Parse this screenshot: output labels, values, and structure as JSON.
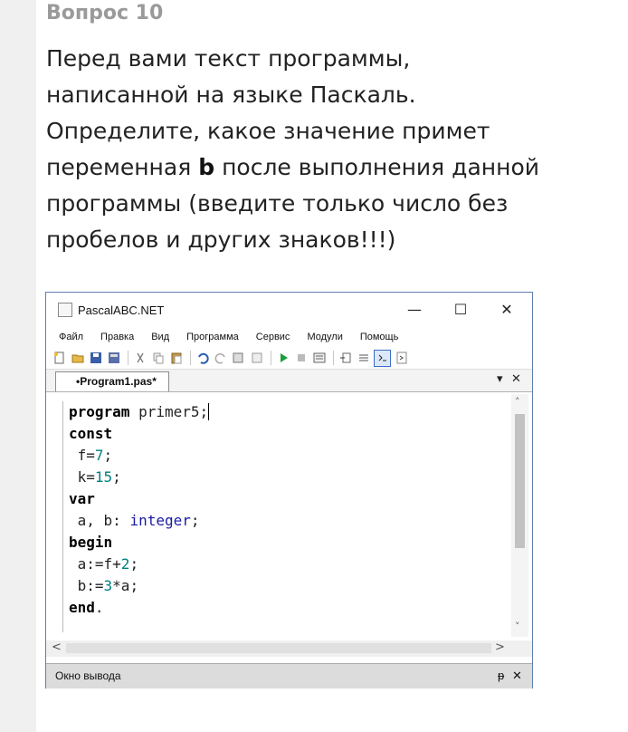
{
  "question": {
    "title": "Вопрос 10",
    "text_before": "Перед вами текст программы, написанной на языке Паскаль. Определите, какое значение примет переменная ",
    "bold_var": "b",
    "text_after": " после выполнения данной программы (введите только число без пробелов и других знаков!!!)"
  },
  "window": {
    "title": "PascalABC.NET",
    "controls": {
      "minimize": "—",
      "maximize": "☐",
      "close": "✕"
    },
    "menu": [
      "Файл",
      "Правка",
      "Вид",
      "Программа",
      "Сервис",
      "Модули",
      "Помощь"
    ],
    "tab": {
      "label": "•Program1.pas*",
      "menu_glyph": "▾",
      "close_glyph": "✕"
    },
    "output_panel": {
      "label": "Окно вывода",
      "pin_glyph": "ᵽ",
      "close_glyph": "✕"
    },
    "toolbar_icons": [
      "new-file-icon",
      "open-folder-icon",
      "save-icon",
      "save-all-icon",
      "cut-icon",
      "copy-icon",
      "paste-icon",
      "undo-icon",
      "redo-icon",
      "find-icon",
      "replace-icon",
      "run-icon",
      "stop-icon",
      "compile-icon",
      "step-into-icon",
      "step-over-icon",
      "console-icon",
      "output-icon"
    ]
  },
  "code": {
    "l1_kw": "program",
    "l1_rest": " primer5;",
    "l2_kw": "const",
    "l3_a": " f=",
    "l3_n": "7",
    "l3_b": ";",
    "l4_a": " k=",
    "l4_n": "15",
    "l4_b": ";",
    "l5_kw": "var",
    "l6_a": " a, b: ",
    "l6_t": "integer",
    "l6_b": ";",
    "l7_kw": "begin",
    "l8_a": " a:=f+",
    "l8_n": "2",
    "l8_b": ";",
    "l9_a": " b:=",
    "l9_n": "3",
    "l9_b": "*a;",
    "l10_kw": "end",
    "l10_b": "."
  },
  "scroll": {
    "up": "˄",
    "down": "˅",
    "left": "<",
    "right": ">"
  }
}
